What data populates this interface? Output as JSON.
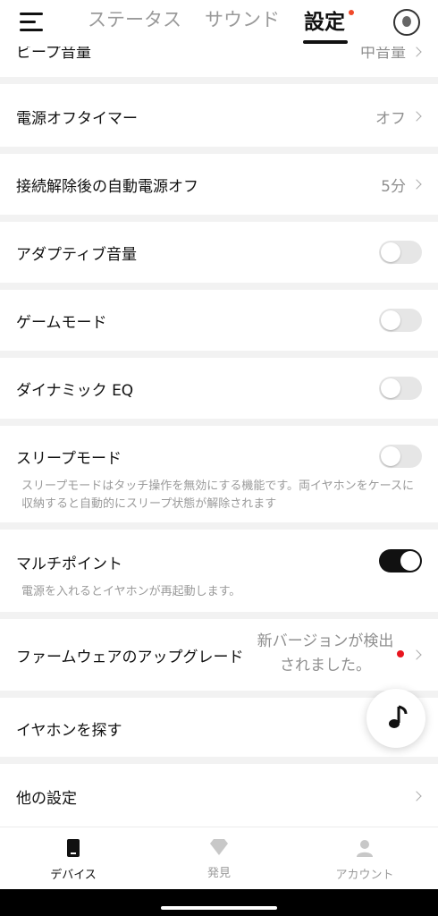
{
  "header": {
    "tabs": [
      {
        "label": "ステータス"
      },
      {
        "label": "サウンド"
      },
      {
        "label": "設定"
      }
    ]
  },
  "settings": {
    "beep_volume": {
      "label": "ビープ音量",
      "value": "中音量"
    },
    "power_off_timer": {
      "label": "電源オフタイマー",
      "value": "オフ"
    },
    "auto_power_off": {
      "label": "接続解除後の自動電源オフ",
      "value": "5分"
    },
    "adaptive_volume": {
      "label": "アダプティブ音量",
      "enabled": false
    },
    "game_mode": {
      "label": "ゲームモード",
      "enabled": false
    },
    "dynamic_eq": {
      "label": "ダイナミック EQ",
      "enabled": false
    },
    "sleep_mode": {
      "label": "スリープモード",
      "enabled": false,
      "description": "スリープモードはタッチ操作を無効にする機能です。両イヤホンをケースに収納すると自動的にスリープ状態が解除されます"
    },
    "multipoint": {
      "label": "マルチポイント",
      "enabled": true,
      "description": "電源を入れるとイヤホンが再起動します。"
    },
    "firmware": {
      "label": "ファームウェアのアップグレード",
      "value": "新バージョンが検出されました。"
    },
    "find_earbuds": {
      "label": "イヤホンを探す"
    },
    "other_settings": {
      "label": "他の設定"
    }
  },
  "bottom_nav": {
    "items": [
      {
        "label": "デバイス",
        "active": true
      },
      {
        "label": "発見",
        "active": false
      },
      {
        "label": "アカウント",
        "active": false
      }
    ]
  },
  "colors": {
    "accent": "#111111",
    "notification_dot": "#e8141e",
    "tab_dot": "#f04a2a"
  }
}
